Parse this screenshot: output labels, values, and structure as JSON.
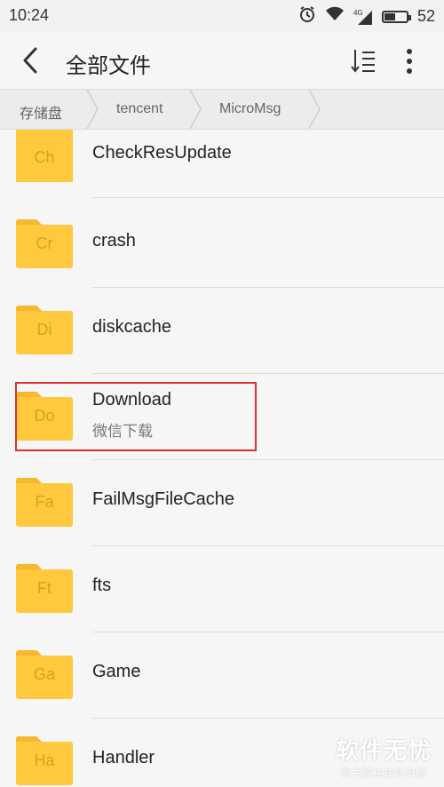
{
  "status_bar": {
    "time": "10:24",
    "network_label": "4G",
    "battery_level": "52"
  },
  "header": {
    "title": "全部文件",
    "back_icon": "chevron-left-icon",
    "sort_icon": "sort-icon",
    "more_icon": "more-vertical-icon"
  },
  "breadcrumb": [
    "存储盘",
    "tencent",
    "MicroMsg"
  ],
  "folders": [
    {
      "abbr": "Ch",
      "name": "CheckResUpdate",
      "sub": ""
    },
    {
      "abbr": "Cr",
      "name": "crash",
      "sub": ""
    },
    {
      "abbr": "Di",
      "name": "diskcache",
      "sub": ""
    },
    {
      "abbr": "Do",
      "name": "Download",
      "sub": "微信下载"
    },
    {
      "abbr": "Fa",
      "name": "FailMsgFileCache",
      "sub": ""
    },
    {
      "abbr": "Ft",
      "name": "fts",
      "sub": ""
    },
    {
      "abbr": "Ga",
      "name": "Game",
      "sub": ""
    },
    {
      "abbr": "Ha",
      "name": "Handler",
      "sub": ""
    }
  ],
  "watermark": {
    "main": "软件无忧",
    "sub": "努力解决软件问题"
  },
  "colors": {
    "folder": "#ffc83d",
    "folder_tab": "#f5b82e",
    "highlight": "#e0312f"
  }
}
